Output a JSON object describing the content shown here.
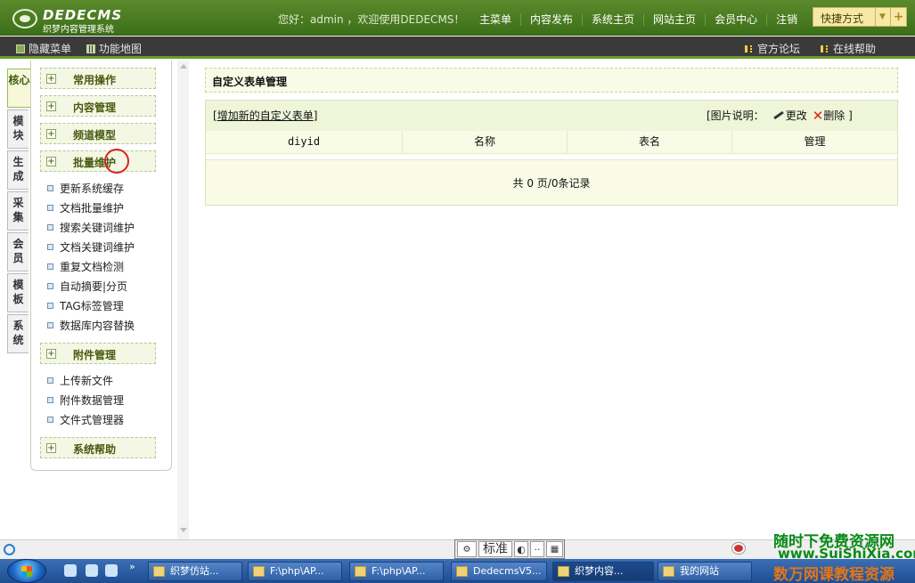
{
  "header": {
    "logo_title": "DEDECMS",
    "logo_subtitle": "织梦内容管理系统",
    "welcome": "您好：admin ，欢迎使用DEDECMS！",
    "nav": [
      "主菜单",
      "内容发布",
      "系统主页",
      "网站主页",
      "会员中心",
      "注销"
    ],
    "quick_label": "快捷方式"
  },
  "subbar": {
    "hide_menu": "隐藏菜单",
    "func_map": "功能地图",
    "forum": "官方论坛",
    "help": "在线帮助"
  },
  "vtabs": [
    "核心",
    "模块",
    "生成",
    "采集",
    "会员",
    "模板",
    "系统"
  ],
  "menu": {
    "groups": [
      "常用操作",
      "内容管理",
      "频道模型",
      "批量维护",
      "附件管理",
      "系统帮助"
    ],
    "batch_items": [
      "更新系统缓存",
      "文档批量维护",
      "搜索关键词维护",
      "文档关键词维护",
      "重复文档检测",
      "自动摘要|分页",
      "TAG标签管理",
      "数据库内容替换"
    ],
    "attach_items": [
      "上传新文件",
      "附件数据管理",
      "文件式管理器"
    ]
  },
  "main": {
    "title": "自定义表单管理",
    "add_link": "增加新的自定义表单",
    "legend_label": "[图片说明：",
    "legend_edit": "更改",
    "legend_delete": "删除 ]",
    "columns": [
      "diyid",
      "名称",
      "表名",
      "管理"
    ],
    "footer": "共 0 页/0条记录"
  },
  "ime": {
    "mode": "标准"
  },
  "taskbar": {
    "tasks": [
      "织梦仿站...",
      "F:\\php\\AP...",
      "F:\\php\\AP...",
      "DedecmsV5...",
      "织梦内容...",
      "我的网站"
    ]
  },
  "watermark": {
    "line1": "随时下免费资源网",
    "line2": "www.SuiShiXia.com",
    "line3": "数万网课教程资源"
  }
}
